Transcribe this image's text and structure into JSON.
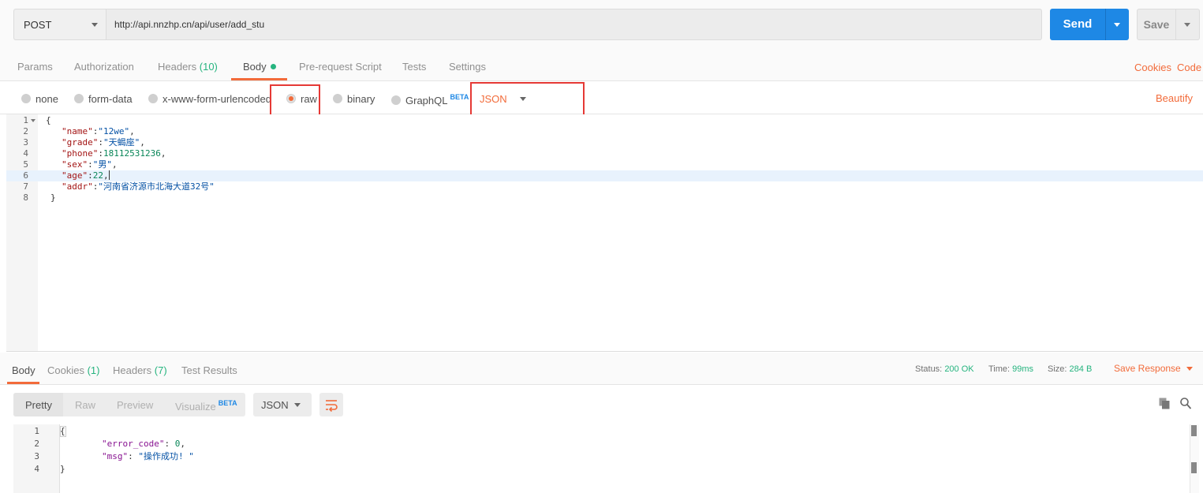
{
  "request": {
    "method": "POST",
    "url": "http://api.nnzhp.cn/api/user/add_stu",
    "send_label": "Send",
    "save_label": "Save"
  },
  "request_tabs": {
    "params": "Params",
    "authorization": "Authorization",
    "headers": "Headers",
    "headers_count": "(10)",
    "body": "Body",
    "prerequest": "Pre-request Script",
    "tests": "Tests",
    "settings": "Settings",
    "cookies": "Cookies",
    "code": "Code"
  },
  "body_types": {
    "none": "none",
    "form_data": "form-data",
    "urlencoded": "x-www-form-urlencoded",
    "raw": "raw",
    "binary": "binary",
    "graphql": "GraphQL",
    "beta": "BETA",
    "format": "JSON",
    "beautify": "Beautify"
  },
  "request_body": {
    "line_numbers": [
      "1",
      "2",
      "3",
      "4",
      "5",
      "6",
      "7",
      "8"
    ],
    "open": "{",
    "close": "}",
    "fields": [
      {
        "key": "\"name\"",
        "value": "\"12we\"",
        "type": "string"
      },
      {
        "key": "\"grade\"",
        "value": "\"天蝎座\"",
        "type": "string"
      },
      {
        "key": "\"phone\"",
        "value": "18112531236",
        "type": "number"
      },
      {
        "key": "\"sex\"",
        "value": "\"男\"",
        "type": "string"
      },
      {
        "key": "\"age\"",
        "value": "22",
        "type": "number"
      },
      {
        "key": "\"addr\"",
        "value": "\"河南省济源市北海大道32号\"",
        "type": "string"
      }
    ]
  },
  "response_tabs": {
    "body": "Body",
    "cookies": "Cookies",
    "cookies_count": "(1)",
    "headers": "Headers",
    "headers_count": "(7)",
    "test_results": "Test Results",
    "status_label": "Status:",
    "status_value": "200 OK",
    "time_label": "Time:",
    "time_value": "99ms",
    "size_label": "Size:",
    "size_value": "284 B",
    "save_response": "Save Response"
  },
  "response_toolbar": {
    "pretty": "Pretty",
    "raw": "Raw",
    "preview": "Preview",
    "visualize": "Visualize",
    "beta": "BETA",
    "format": "JSON"
  },
  "response_body": {
    "line_numbers": [
      "1",
      "2",
      "3",
      "4"
    ],
    "open": "{",
    "close": "}",
    "error_code_key": "\"error_code\"",
    "error_code_value": "0",
    "msg_key": "\"msg\"",
    "msg_value": "\"操作成功! \""
  },
  "colors": {
    "accent": "#f26b3a",
    "send_blue": "#1e88e5",
    "success_green": "#26b47f",
    "highlight_red": "#e53935"
  }
}
